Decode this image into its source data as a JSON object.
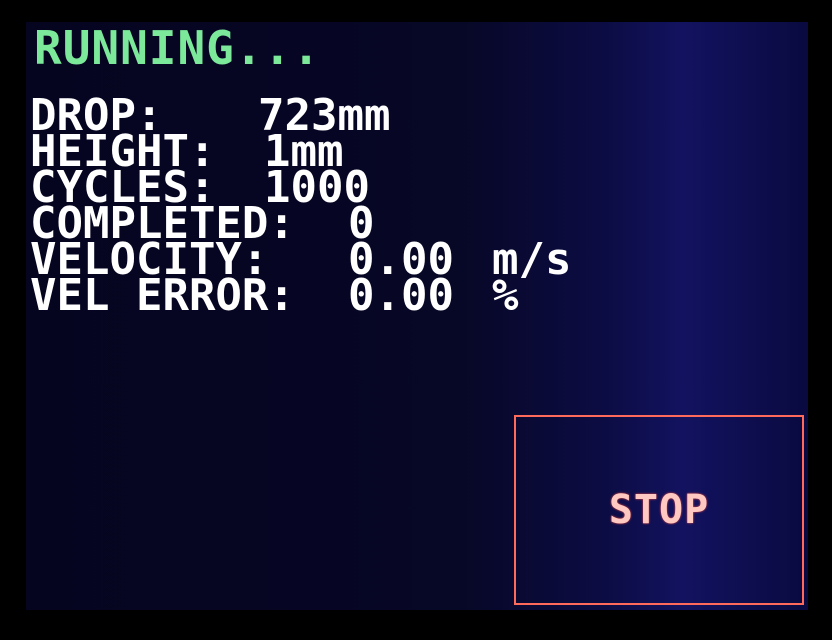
{
  "status": "RUNNING...",
  "readouts": {
    "drop": {
      "label": "DROP:",
      "value": "723mm"
    },
    "height": {
      "label": "HEIGHT:",
      "value": "1mm"
    },
    "cycles": {
      "label": "CYCLES:",
      "value": "1000"
    },
    "completed": {
      "label": "COMPLETED:",
      "value": "0"
    },
    "velocity": {
      "label": "VELOCITY:",
      "value": "0.00",
      "unit": "m/s"
    },
    "vel_error": {
      "label": "VEL ERROR:",
      "value": "0.00",
      "unit": "%"
    }
  },
  "stop_button": {
    "label": "STOP"
  },
  "colors": {
    "status": "#7be89a",
    "text": "#ffffff",
    "stop_border": "#ff6a5a",
    "background": "#070726"
  }
}
